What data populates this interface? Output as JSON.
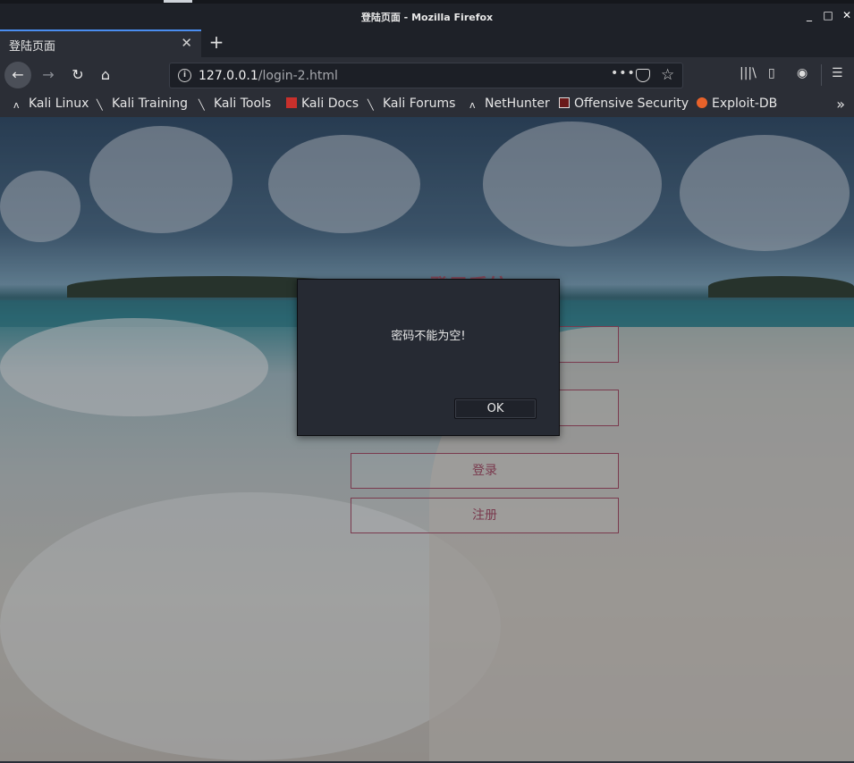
{
  "window": {
    "title": "登陆页面 - Mozilla Firefox"
  },
  "tab": {
    "label": "登陆页面"
  },
  "url": {
    "host": "127.0.0.1",
    "path": "/login-2.html"
  },
  "bookmarks": [
    {
      "label": "Kali Linux",
      "icon": "kali-dragon-icon"
    },
    {
      "label": "Kali Training",
      "icon": "kali-knife-icon"
    },
    {
      "label": "Kali Tools",
      "icon": "kali-knife-icon"
    },
    {
      "label": "Kali Docs",
      "icon": "docs-red-icon"
    },
    {
      "label": "Kali Forums",
      "icon": "kali-knife-icon"
    },
    {
      "label": "NetHunter",
      "icon": "kali-dragon-icon"
    },
    {
      "label": "Offensive Security",
      "icon": "offsec-icon"
    },
    {
      "label": "Exploit-DB",
      "icon": "exploitdb-icon"
    }
  ],
  "page": {
    "title": "登录系统",
    "login_button": "登录",
    "register_button": "注册"
  },
  "dialog": {
    "message": "密码不能为空!",
    "ok_label": "OK"
  }
}
